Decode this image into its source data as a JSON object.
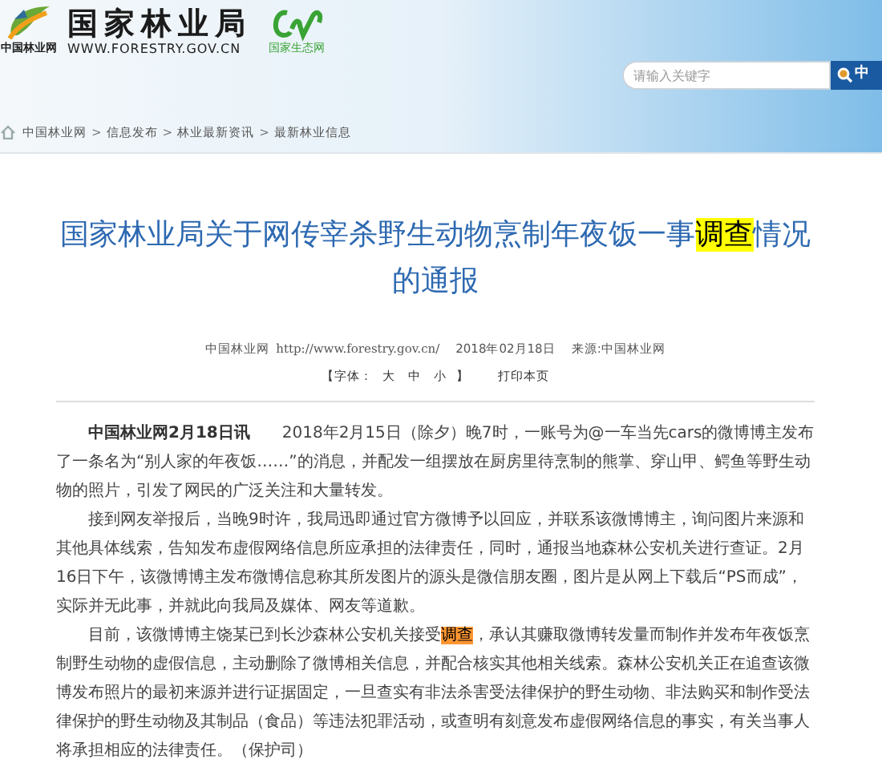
{
  "header": {
    "site_name": "国家林业局",
    "site_url": "WWW.FORESTRY.GOV.CN",
    "logo_caption": "中国林业网",
    "partner_caption": "国家生态网",
    "search": {
      "placeholder": "请输入关键字",
      "button": "中"
    }
  },
  "breadcrumb": {
    "separator": ">",
    "items": [
      "中国林业网",
      "信息发布",
      "林业最新资讯",
      "最新林业信息"
    ]
  },
  "article": {
    "title": [
      {
        "text": "国家林业局关于网传宰杀野生动物烹制年夜饭一事",
        "kind": "plain"
      },
      {
        "text": "调查",
        "kind": "highlight"
      },
      {
        "text": "情况的通报",
        "kind": "plain"
      }
    ],
    "meta": {
      "site": "中国林业网",
      "url": "http://www.forestry.gov.cn/",
      "date": "2018年02月18日",
      "source": "来源:中国林业网"
    },
    "font_size": {
      "label": "【字体：",
      "sizes": [
        "大",
        "中",
        "小"
      ],
      "close": "】"
    },
    "print": "打印本页",
    "paragraphs": [
      {
        "runs": [
          {
            "text": "中国林业网2月18日讯",
            "kind": "lead"
          },
          {
            "text": "　　2018年2月15日（除夕）晚7时，一账号为@一车当先cars的微博博主发布了一条名为“别人家的年夜饭……”的消息，并配发一组摆放在厨房里待烹制的熊掌、穿山甲、鳄鱼等野生动物的照片，引发了网民的广泛关注和大量转发。",
            "kind": "plain"
          }
        ]
      },
      {
        "runs": [
          {
            "text": "接到网友举报后，当晚9时许，我局迅即通过官方微博予以回应，并联系该微博博主，询问图片来源和其他具体线索，告知发布虚假网络信息所应承担的法律责任，同时，通报当地森林公安机关进行查证。2月16日下午，该微博博主发布微博信息称其所发图片的源头是微信朋友圈，图片是从网上下载后“PS而成”，实际并无此事，并就此向我局及媒体、网友等道歉。",
            "kind": "plain"
          }
        ]
      },
      {
        "runs": [
          {
            "text": "目前，该微博博主饶某已到长沙森林公安机关接受",
            "kind": "plain"
          },
          {
            "text": "调查",
            "kind": "mark"
          },
          {
            "text": "，承认其赚取微博转发量而制作并发布年夜饭烹制野生动物的虚假信息，主动删除了微博相关信息，并配合核实其他相关线索。森林公安机关正在追查该微博发布照片的最初来源并进行证据固定，一旦查实有非法杀害受法律保护的野生动物、非法购买和制作受法律保护的野生动物及其制品（食品）等违法犯罪活动，或查明有刻意发布虚假网络信息的事实，有关当事人将承担相应的法律责任。（保护司）",
            "kind": "plain"
          }
        ]
      }
    ]
  }
}
